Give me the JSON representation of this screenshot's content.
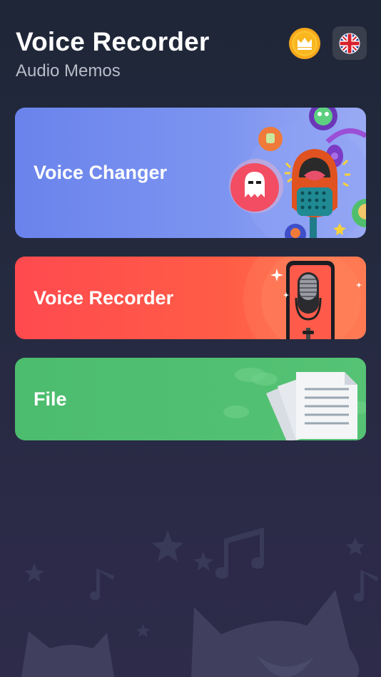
{
  "header": {
    "title": "Voice Recorder",
    "subtitle": "Audio Memos",
    "premium_icon": "crown-icon",
    "language_icon": "uk-flag-icon"
  },
  "cards": [
    {
      "label": "Voice Changer",
      "color": "#7088ee",
      "icon": "monster-microphone-illustration"
    },
    {
      "label": "Voice Recorder",
      "color": "#ff5148",
      "icon": "phone-microphone-illustration"
    },
    {
      "label": "File",
      "color": "#4fbe70",
      "icon": "documents-illustration"
    }
  ],
  "colors": {
    "background": "#242a3d",
    "premium_gold": "#f7a81c"
  }
}
